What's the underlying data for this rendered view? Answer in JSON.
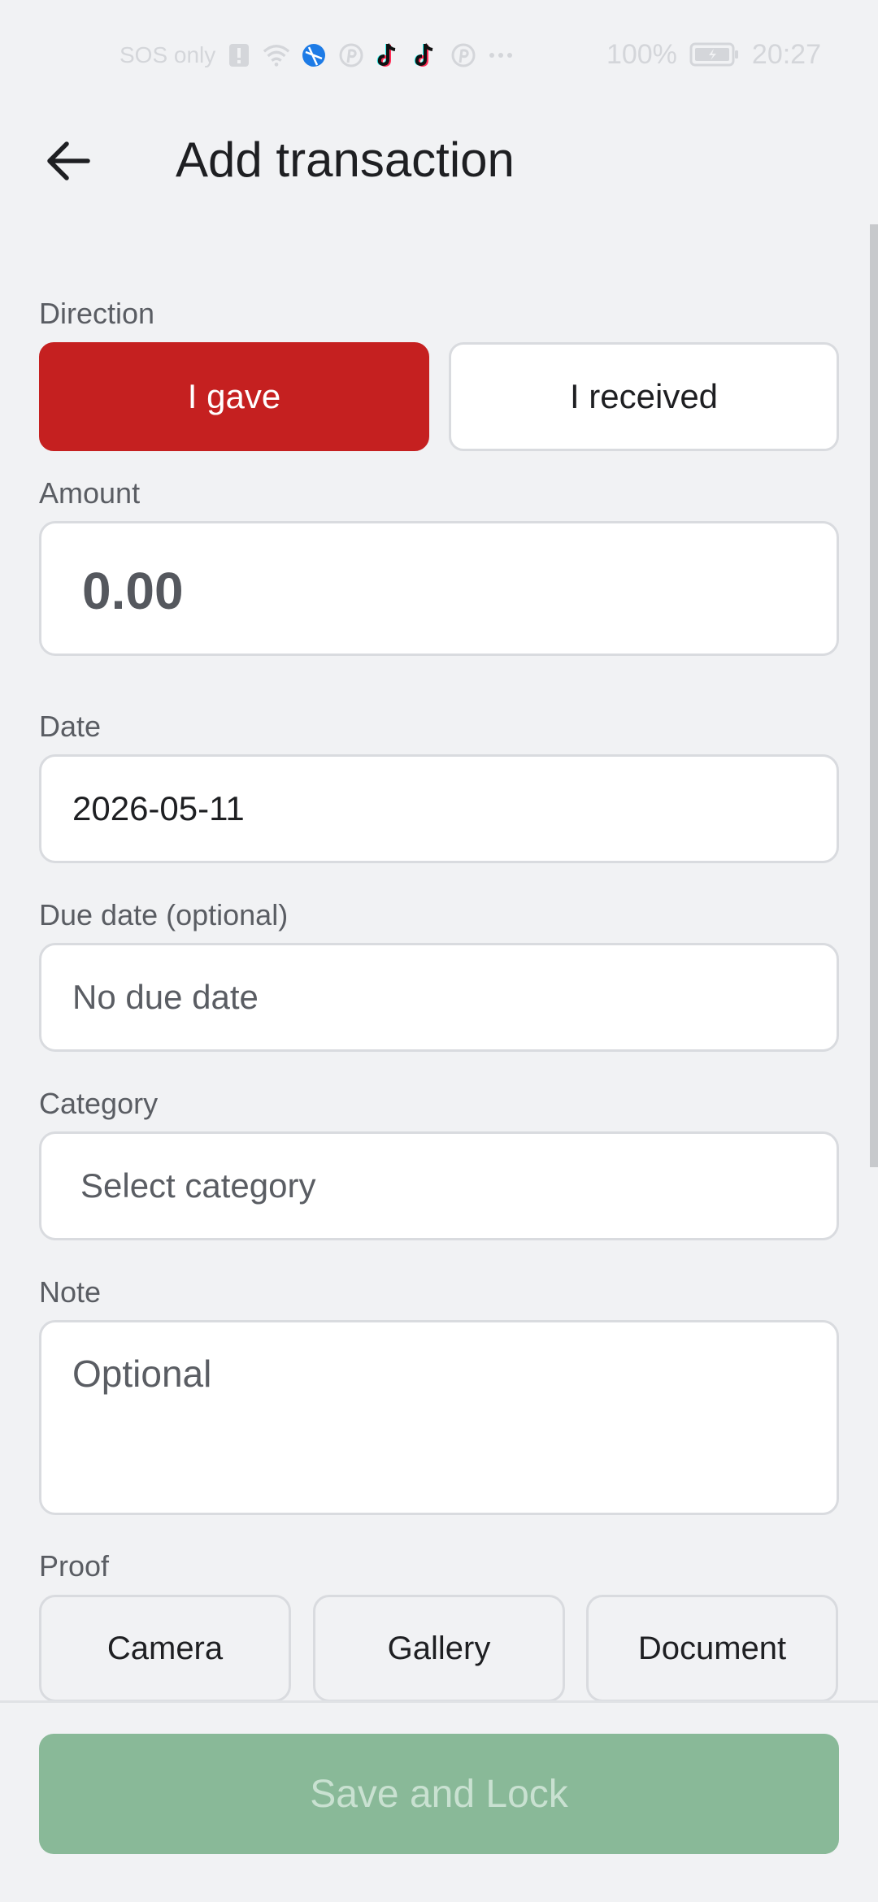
{
  "status_bar": {
    "carrier": "SOS only",
    "battery": "100%",
    "time": "20:27",
    "icons": [
      "alert-icon",
      "wifi-icon",
      "vpn-globe-icon",
      "pinterest-icon",
      "tiktok-icon",
      "tiktok-icon",
      "pinterest-icon",
      "more-dots-icon",
      "battery-icon"
    ]
  },
  "header": {
    "title": "Add transaction",
    "back_icon": "arrow-left-icon"
  },
  "form": {
    "direction": {
      "label": "Direction",
      "options": [
        "I gave",
        "I received"
      ],
      "selected": "I gave"
    },
    "amount": {
      "label": "Amount",
      "value": "0.00"
    },
    "date": {
      "label": "Date",
      "value": "2026-05-11"
    },
    "due_date": {
      "label": "Due date (optional)",
      "placeholder": "No due date"
    },
    "category": {
      "label": "Category",
      "placeholder": "Select category"
    },
    "note": {
      "label": "Note",
      "placeholder": "Optional"
    },
    "proof": {
      "label": "Proof",
      "buttons": [
        "Camera",
        "Gallery",
        "Document"
      ]
    }
  },
  "footer": {
    "save_label": "Save and Lock"
  },
  "colors": {
    "accent_red": "#c52020",
    "save_green_disabled": "#89b998",
    "background": "#f1f2f4"
  }
}
